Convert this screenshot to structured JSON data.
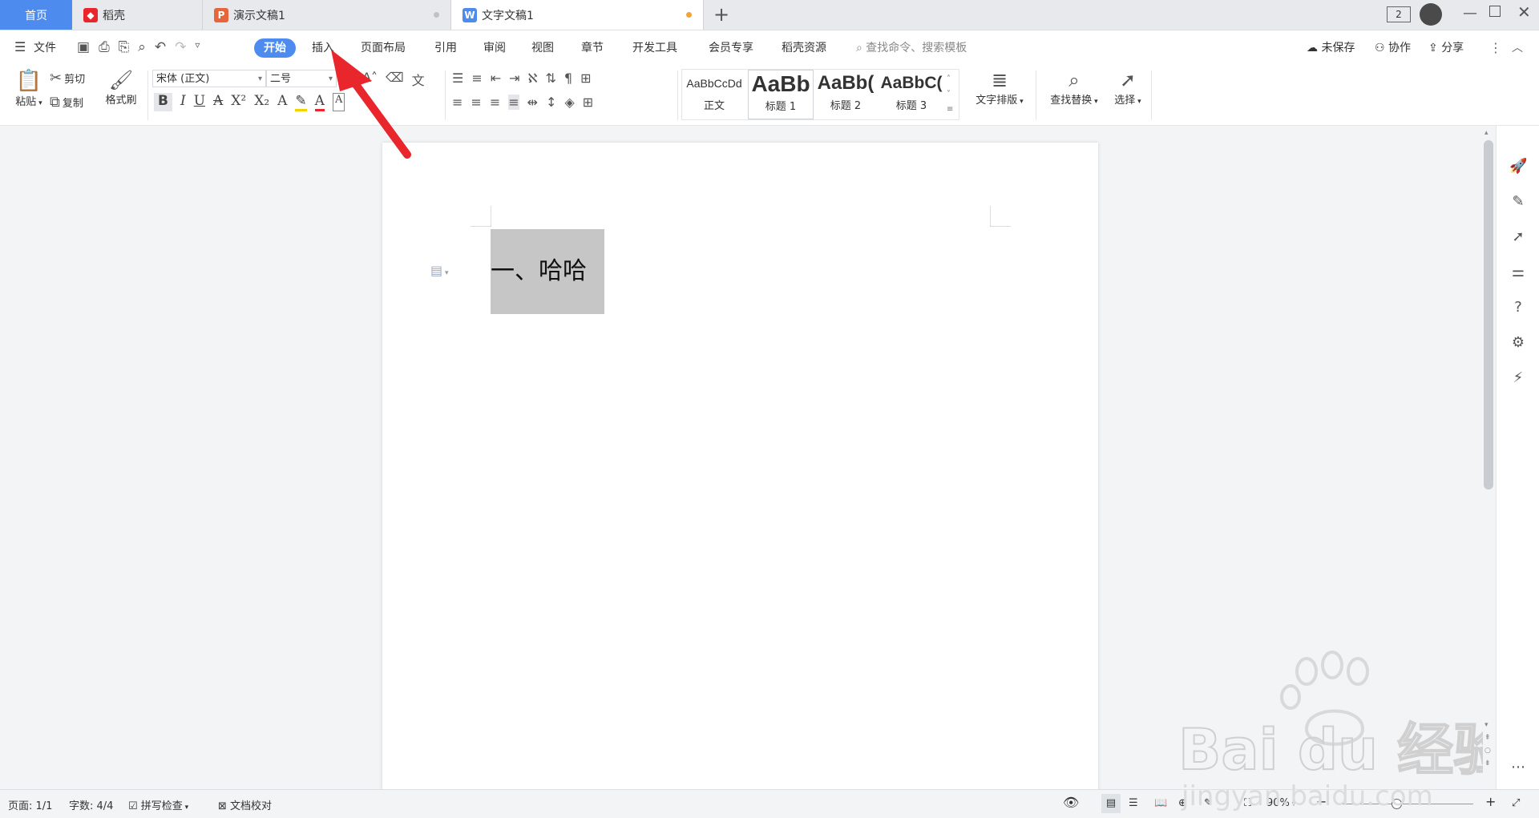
{
  "tabs": {
    "home": "首页",
    "daoke": "稻壳",
    "presentation": "演示文稿1",
    "document": "文字文稿1",
    "new_tab": "+"
  },
  "window_badge": "2",
  "menu": {
    "file": "文件",
    "items": [
      "开始",
      "插入",
      "页面布局",
      "引用",
      "审阅",
      "视图",
      "章节",
      "开发工具",
      "会员专享",
      "稻壳资源"
    ],
    "search_placeholder": "查找命令、搜索模板",
    "unsaved": "未保存",
    "collab": "协作",
    "share": "分享"
  },
  "ribbon": {
    "paste": "粘贴",
    "cut": "剪切",
    "copy": "复制",
    "format_painter": "格式刷",
    "font_name": "宋体 (正文)",
    "font_size": "二号",
    "styles": [
      {
        "sample": "AaBbCcDd",
        "label": "正文"
      },
      {
        "sample": "AaBb",
        "label": "标题 1"
      },
      {
        "sample": "AaBb(",
        "label": "标题 2"
      },
      {
        "sample": "AaBbC(",
        "label": "标题 3"
      }
    ],
    "text_layout": "文字排版",
    "find_replace": "查找替换",
    "select": "选择"
  },
  "document": {
    "heading": "一、哈哈"
  },
  "status": {
    "page": "页面: 1/1",
    "words": "字数: 4/4",
    "spell": "拼写检查",
    "proof": "文档校对",
    "zoom": "90%"
  },
  "watermark": {
    "brand": "Bai du 经验",
    "url": "jingyan.baidu.com"
  },
  "colors": {
    "accent": "#4d8bef",
    "arrow": "#e8262b",
    "selection": "#c6c6c6"
  }
}
